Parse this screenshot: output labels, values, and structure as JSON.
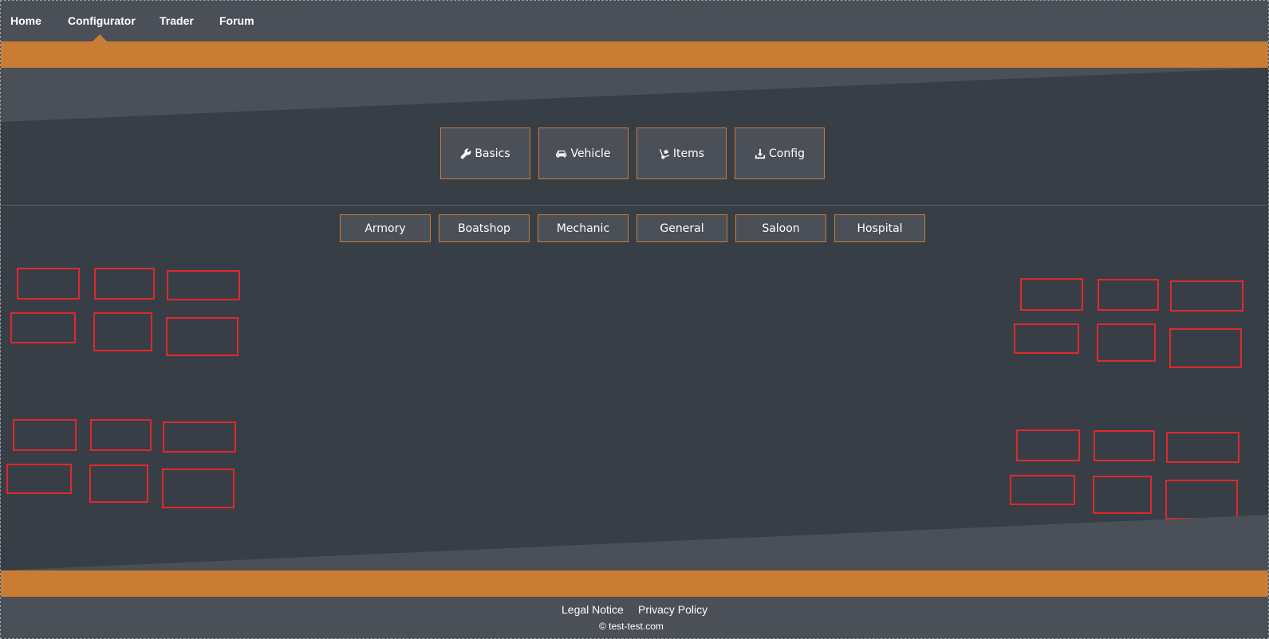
{
  "nav": {
    "items": [
      {
        "label": "Home"
      },
      {
        "label": "Configurator",
        "active": true
      },
      {
        "label": "Trader"
      },
      {
        "label": "Forum"
      }
    ]
  },
  "main_tabs": [
    {
      "label": "Basics",
      "icon": "wrench-icon"
    },
    {
      "label": "Vehicle",
      "icon": "car-icon"
    },
    {
      "label": "Items",
      "icon": "dolly-icon"
    },
    {
      "label": "Config",
      "icon": "download-icon"
    }
  ],
  "sub_tabs": [
    {
      "label": "Armory"
    },
    {
      "label": "Boatshop"
    },
    {
      "label": "Mechanic"
    },
    {
      "label": "General"
    },
    {
      "label": "Saloon"
    },
    {
      "label": "Hospital"
    }
  ],
  "footer": {
    "legal": "Legal Notice",
    "privacy": "Privacy Policy",
    "copyright": "© test-test.com"
  },
  "colors": {
    "accent": "#c97c34",
    "panel": "#4b5058",
    "background": "#373e45",
    "slot_border": "#e0282d"
  }
}
